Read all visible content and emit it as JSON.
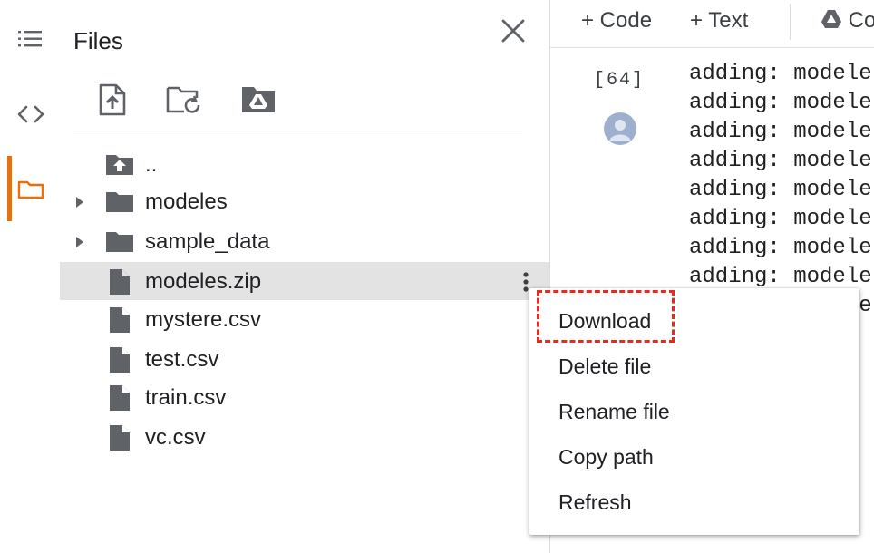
{
  "colors": {
    "accent": "#e8710a",
    "highlight": "#e8291c",
    "icon_gray": "#5f6368",
    "selected_row": "#e3e3e3"
  },
  "sidebar": {
    "icons": [
      {
        "name": "table-of-contents-icon",
        "active": false
      },
      {
        "name": "code-snippets-icon",
        "active": false
      },
      {
        "name": "folder-icon",
        "active": true
      }
    ]
  },
  "files_panel": {
    "title": "Files",
    "toolbar": [
      {
        "name": "upload-file-icon"
      },
      {
        "name": "refresh-folder-icon"
      },
      {
        "name": "mount-drive-icon"
      }
    ],
    "items": [
      {
        "label": "..",
        "type": "parent"
      },
      {
        "label": "modeles",
        "type": "folder"
      },
      {
        "label": "sample_data",
        "type": "folder"
      },
      {
        "label": "modeles.zip",
        "type": "file",
        "selected": true
      },
      {
        "label": "mystere.csv",
        "type": "file"
      },
      {
        "label": "test.csv",
        "type": "file"
      },
      {
        "label": "train.csv",
        "type": "file"
      },
      {
        "label": "vc.csv",
        "type": "file"
      }
    ]
  },
  "notebook_toolbar": {
    "code": "+ Code",
    "text": "+ Text",
    "drive": "Co"
  },
  "cell": {
    "execution_count": "[64]",
    "output_lines": [
      "adding: modele",
      "adding: modele",
      "adding: modele",
      "adding: modele",
      "adding: modele",
      "adding: modele",
      "adding: modele",
      "adding: modele",
      "adding: modele"
    ]
  },
  "context_menu": {
    "items": [
      {
        "label": "Download",
        "highlighted": true
      },
      {
        "label": "Delete file"
      },
      {
        "label": "Rename file"
      },
      {
        "label": "Copy path"
      },
      {
        "label": "Refresh"
      }
    ]
  }
}
